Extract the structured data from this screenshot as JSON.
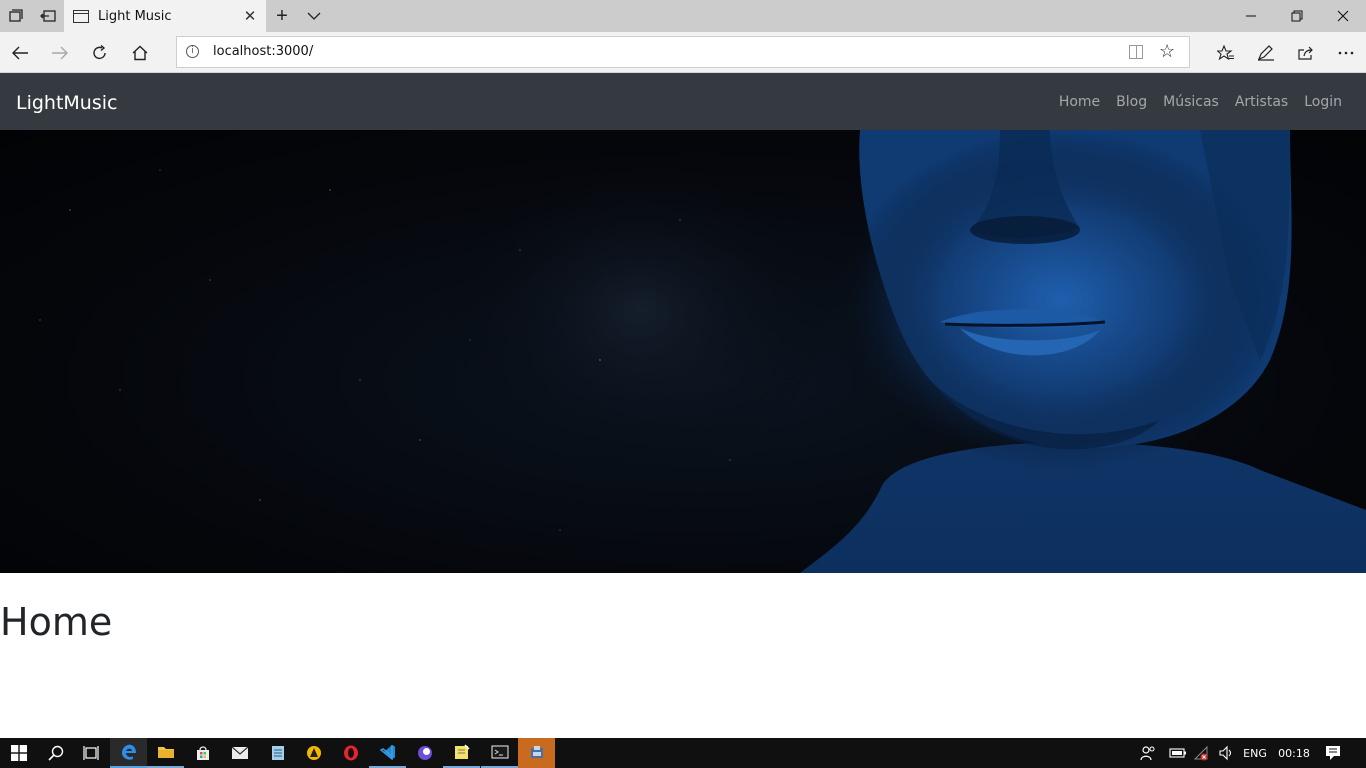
{
  "browser": {
    "tab_title": "Light Music",
    "url": "localhost:3000/",
    "new_tab_glyph": "+",
    "tab_list_glyph": "⌄",
    "close_glyph": "✕"
  },
  "site": {
    "brand": "LightMusic",
    "nav_links": [
      "Home",
      "Blog",
      "Músicas",
      "Artistas",
      "Login"
    ],
    "page_heading": "Home"
  },
  "taskbar": {
    "language": "ENG",
    "time": "00:18"
  },
  "colors": {
    "navbar_bg": "#343a40",
    "accent_blue": "#1e5aa8"
  },
  "icons": [
    "tab-aside-icon",
    "tab-back-icon",
    "tab-page-icon",
    "back-icon",
    "forward-icon",
    "refresh-icon",
    "home-icon",
    "info-icon",
    "reading-view-icon",
    "favorite-star-icon",
    "favorites-icon",
    "notes-icon",
    "share-icon",
    "more-icon",
    "windows-start-icon",
    "search-icon",
    "task-view-icon",
    "edge-icon",
    "file-explorer-icon",
    "store-icon",
    "mail-icon",
    "notepad-icon",
    "app-yellow-icon",
    "opera-icon",
    "vscode-icon",
    "app-purple-icon",
    "sticky-notes-icon",
    "terminal-icon",
    "app-active-icon",
    "people-icon",
    "battery-icon",
    "network-icon",
    "volume-icon",
    "notification-icon"
  ]
}
